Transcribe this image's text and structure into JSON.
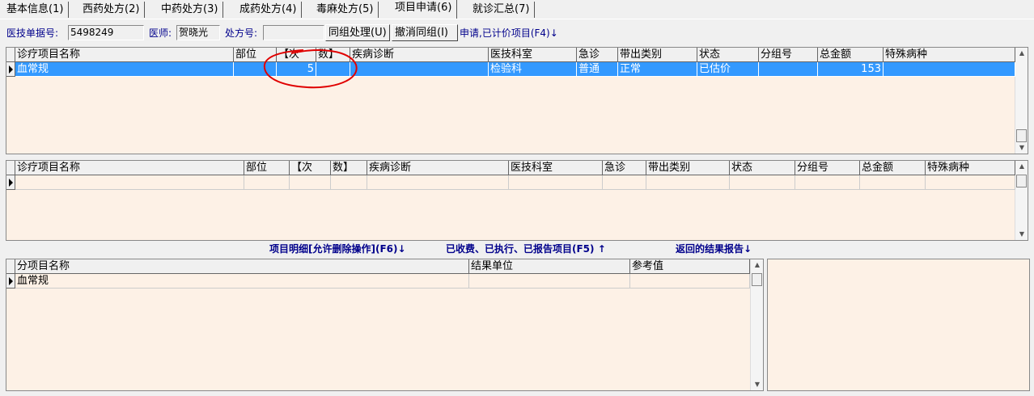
{
  "tabs": [
    "基本信息(1)",
    "西药处方(2)",
    "中药处方(3)",
    "成药处方(4)",
    "毒麻处方(5)",
    "项目申请(6)",
    "就诊汇总(7)"
  ],
  "active_tab": 5,
  "toolbar": {
    "bill_label": "医技单据号:",
    "bill_value": "5498249",
    "doctor_label": "医师:",
    "doctor_value": "贺晓光",
    "rx_label": "处方号:",
    "rx_value": "",
    "group_btn": "同组处理(U)",
    "ungroup_btn": "撤消同组(I)",
    "priced_link": "申请,已计价项目(F4)↓"
  },
  "grid1": {
    "headers": [
      "诊疗项目名称",
      "部位",
      "【次",
      "数】",
      "疾病诊断",
      "医技科室",
      "急诊",
      "带出类别",
      "状态",
      "分组号",
      "总金额",
      "特殊病种"
    ],
    "rows": [
      [
        "血常规",
        "",
        "5",
        "",
        "",
        "检验科",
        "普通",
        "正常",
        "已估价",
        "",
        "153",
        ""
      ]
    ]
  },
  "grid2": {
    "headers": [
      "诊疗项目名称",
      "部位",
      "【次",
      "数】",
      "疾病诊断",
      "医技科室",
      "急诊",
      "带出类别",
      "状态",
      "分组号",
      "总金额",
      "特殊病种"
    ],
    "rows": [
      [
        "",
        "",
        "",
        "",
        "",
        "",
        "",
        "",
        "",
        "",
        "",
        ""
      ]
    ]
  },
  "links": {
    "detail": "项目明细[允许删除操作](F6)↓",
    "charged": "已收费、已执行、已报告项目(F5) ↑",
    "report": "返回的结果报告↓"
  },
  "grid3": {
    "headers": [
      "分项目名称",
      "结果单位",
      "参考值"
    ],
    "rows": [
      [
        "血常规",
        "",
        ""
      ]
    ]
  },
  "annotation_color": "#e00000"
}
